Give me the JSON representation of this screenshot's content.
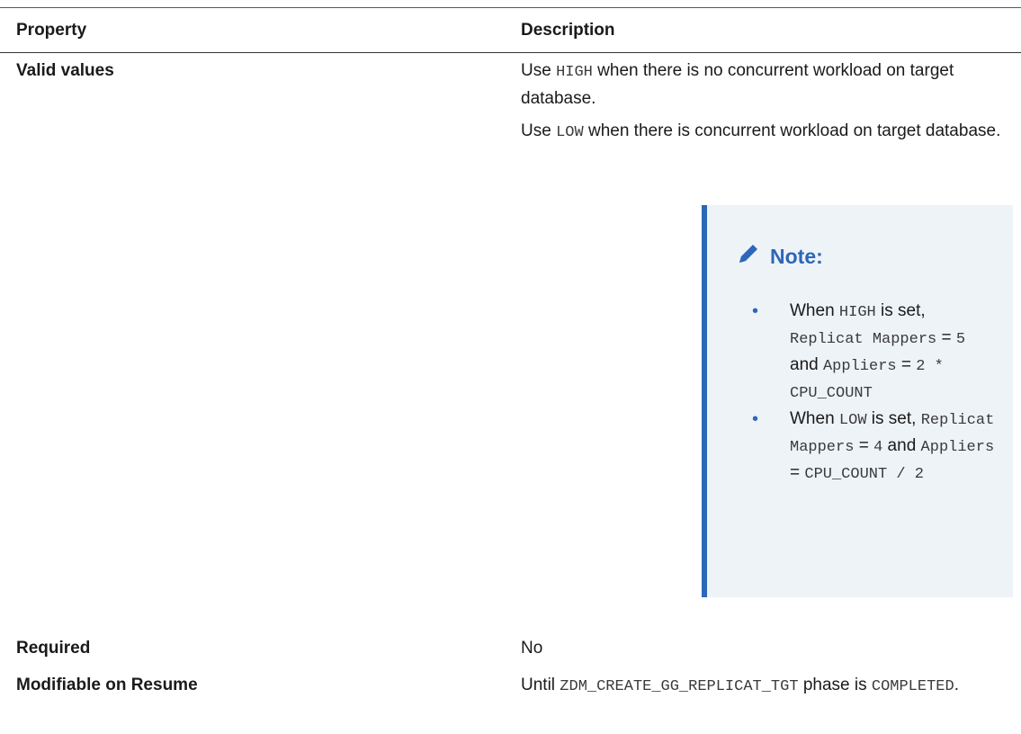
{
  "headers": {
    "property": "Property",
    "description": "Description"
  },
  "rows": {
    "valid_values": {
      "label": "Valid values",
      "p1_pre": "Use ",
      "p1_code": "HIGH",
      "p1_post": " when there is no concurrent workload on target database.",
      "p2_pre": "Use ",
      "p2_code": "LOW",
      "p2_post": " when there is concurrent workload on target database."
    },
    "required": {
      "label": "Required",
      "value": "No"
    },
    "modifiable": {
      "label": "Modifiable on Resume",
      "pre": "Until ",
      "code": "ZDM_CREATE_GG_REPLICAT_TGT",
      "post": " phase is ",
      "code2": "COMPLETED",
      "end": "."
    }
  },
  "note": {
    "title": "Note:",
    "icon": "pencil-icon",
    "items": [
      {
        "a": "When ",
        "b": "HIGH",
        "c": " is set, ",
        "d": "Replicat Mappers",
        "e": " = ",
        "f": "5",
        "g": " and ",
        "h": "Appliers",
        "i": " = ",
        "j": "2 * CPU_COUNT"
      },
      {
        "a": "When ",
        "b": "LOW",
        "c": " is set, ",
        "d": "Replicat Mappers",
        "e": " = ",
        "f": "4",
        "g": " and ",
        "h": "Appliers",
        "i": " = ",
        "j": "CPU_COUNT / 2"
      }
    ]
  },
  "colors": {
    "accent": "#2c67b8",
    "note_bg": "#eef3f8"
  }
}
